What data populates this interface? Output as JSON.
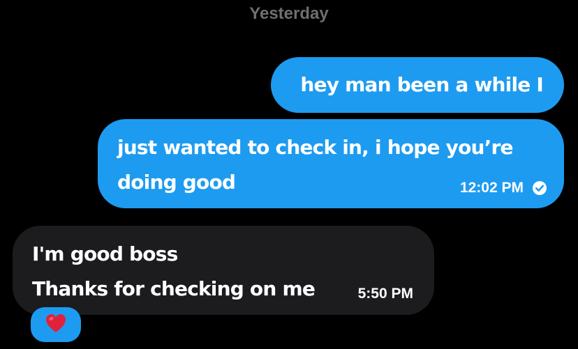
{
  "thread": {
    "date_separator": "Yesterday"
  },
  "messages": [
    {
      "direction": "outgoing",
      "lines": [
        "hey man been a while I"
      ]
    },
    {
      "direction": "outgoing",
      "lines": [
        "just wanted to check in, i hope you’re",
        "doing good"
      ],
      "time": "12:02 PM",
      "status_icon": "read-check-icon"
    },
    {
      "direction": "incoming",
      "lines": [
        "I'm good boss",
        "Thanks for checking on me"
      ],
      "time": "5:50 PM",
      "reaction": "heart-emoji-icon"
    }
  ],
  "colors": {
    "background": "#000000",
    "outgoing_bubble": "#1d9bf0",
    "incoming_bubble": "#1c1c1e",
    "date_separator": "#6e6e73",
    "heart": "#e0213a"
  }
}
